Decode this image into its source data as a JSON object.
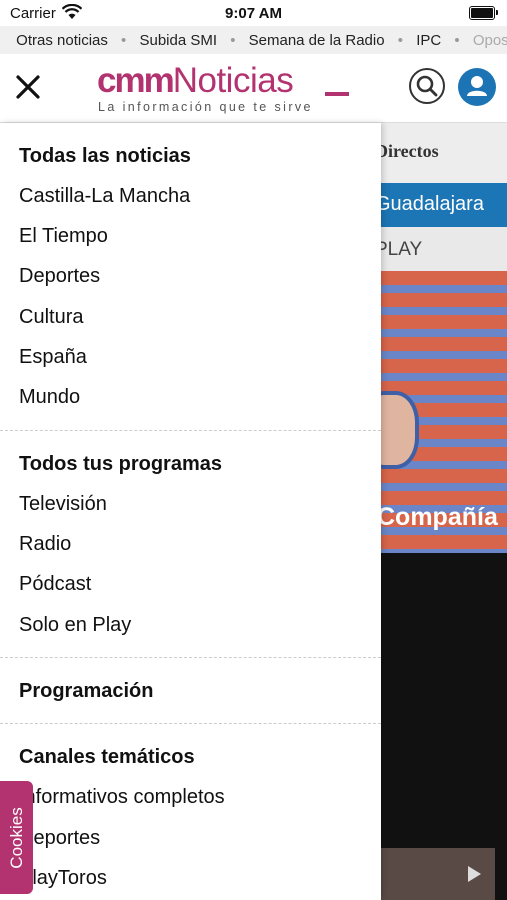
{
  "status_bar": {
    "carrier": "Carrier",
    "time": "9:07 AM"
  },
  "ticker": [
    "Otras noticias",
    "Subida SMI",
    "Semana de la Radio",
    "IPC",
    "Opos"
  ],
  "header": {
    "logo_cmm": "cmm",
    "logo_noticias": "Noticias",
    "slogan": "La información que te sirve"
  },
  "menu": {
    "news_heading": "Todas las noticias",
    "news_items": [
      "Castilla-La Mancha",
      "El Tiempo",
      "Deportes",
      "Cultura",
      "España",
      "Mundo"
    ],
    "programs_heading": "Todos tus programas",
    "programs_items": [
      "Televisión",
      "Radio",
      "Pódcast",
      "Solo en Play"
    ],
    "schedule_heading": "Programación",
    "channels_heading": "Canales temáticos",
    "channels_items": [
      "Informativos completos",
      "Deportes",
      "PlayToros"
    ]
  },
  "background": {
    "section_label": "Directos",
    "tab_label": "Guadalajara",
    "tab2_label": "PLAY",
    "image_caption": "Compañía"
  },
  "cookies_label": "Cookies",
  "colors": {
    "brand": "#b2336f",
    "accent_blue": "#1c74b5"
  }
}
